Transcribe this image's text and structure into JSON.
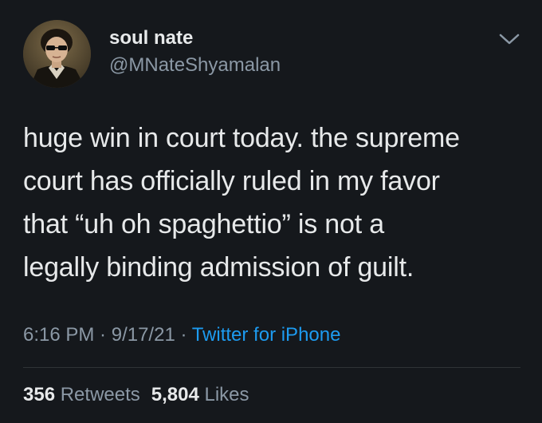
{
  "user": {
    "display_name": "soul nate",
    "handle": "@MNateShyamalan"
  },
  "tweet": {
    "lines": [
      "huge win in court today. the supreme",
      "court has officially ruled in my favor",
      "that “uh oh spaghettio” is not a",
      "legally binding admission of guilt."
    ],
    "time": "6:16 PM",
    "sep1": " · ",
    "date": "9/17/21",
    "sep2": " · ",
    "source": "Twitter for iPhone"
  },
  "stats": {
    "retweets_count": "356",
    "retweets_label": " Retweets",
    "likes_count": "5,804",
    "likes_label": " Likes"
  },
  "icons": {
    "menu": "chevron-down-icon"
  },
  "colors": {
    "background": "#15181c",
    "text_primary": "#e7e9ea",
    "text_secondary": "#8b98a5",
    "link": "#1d9bf0",
    "divider": "#2f3336"
  }
}
